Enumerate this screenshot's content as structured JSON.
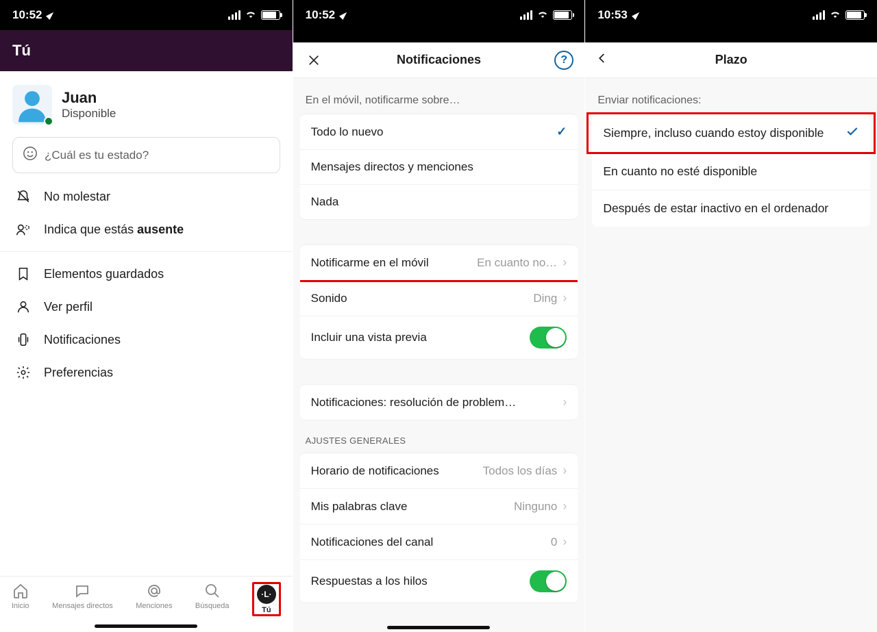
{
  "statusbar": {
    "t1": "10:52",
    "t2": "10:52",
    "t3": "10:53"
  },
  "screen1": {
    "header": "Tú",
    "user": {
      "name": "Juan",
      "status": "Disponible"
    },
    "status_placeholder": "¿Cuál es tu estado?",
    "no_molestar": "No molestar",
    "ausente_prefix": "Indica que estás ",
    "ausente_bold": "ausente",
    "items": {
      "saved": "Elementos guardados",
      "profile": "Ver perfil",
      "notifs": "Notificaciones",
      "prefs": "Preferencias"
    },
    "tabs": {
      "home": "Inicio",
      "dms": "Mensajes directos",
      "mentions": "Menciones",
      "search": "Búsqueda",
      "you": "Tú",
      "you_avatar": "·L·"
    }
  },
  "screen2": {
    "title": "Notificaciones",
    "section_mobile_notify": "En el móvil, notificarme sobre…",
    "opts": {
      "all": "Todo lo nuevo",
      "dm": "Mensajes directos y menciones",
      "none": "Nada"
    },
    "notify_mobile": "Notificarme en el móvil",
    "notify_mobile_val": "En cuanto no…",
    "sound": "Sonido",
    "sound_val": "Ding",
    "preview": "Incluir una vista previa",
    "troubleshoot": "Notificaciones: resolución de problem…",
    "general_header": "AJUSTES GENERALES",
    "schedule": "Horario de notificaciones",
    "schedule_val": "Todos los días",
    "keywords": "Mis palabras clave",
    "keywords_val": "Ninguno",
    "channel": "Notificaciones del canal",
    "channel_val": "0",
    "threads": "Respuestas a los hilos"
  },
  "screen3": {
    "title": "Plazo",
    "section": "Enviar notificaciones:",
    "opt1": "Siempre, incluso cuando estoy disponible",
    "opt2": "En cuanto no esté disponible",
    "opt3": "Después de estar inactivo en el ordenador"
  }
}
